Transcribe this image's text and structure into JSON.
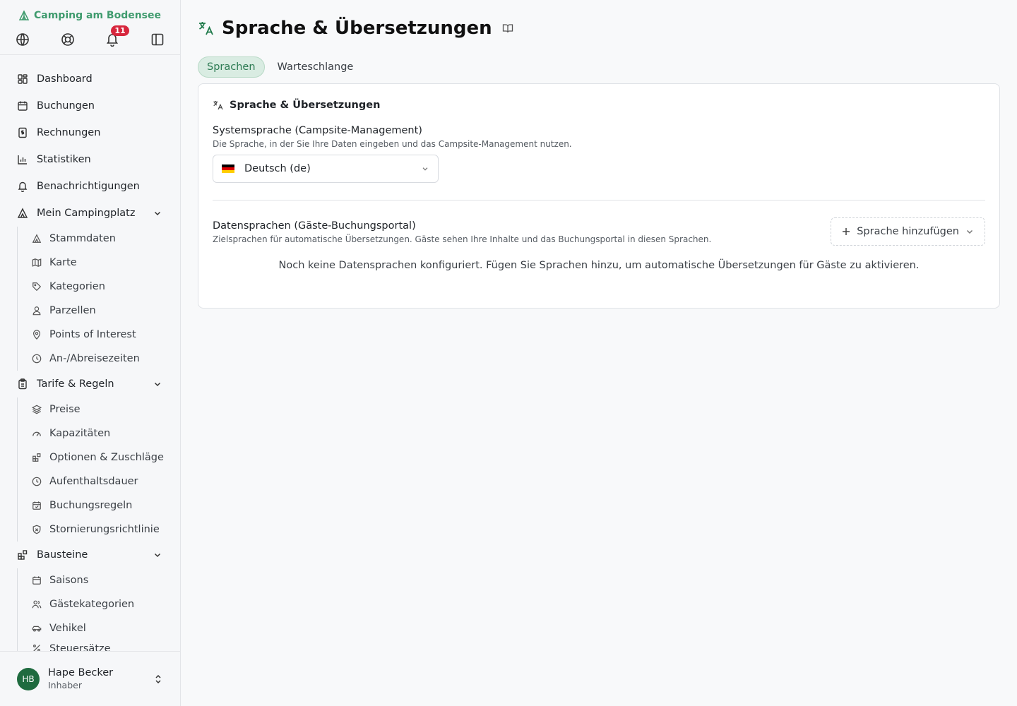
{
  "brand": {
    "name": "Camping am Bodensee"
  },
  "notifications": {
    "count": "11"
  },
  "nav": {
    "dashboard": "Dashboard",
    "buchungen": "Buchungen",
    "rechnungen": "Rechnungen",
    "statistiken": "Statistiken",
    "benachrichtigungen": "Benachrichtigungen",
    "mein_campingplatz": {
      "label": "Mein Campingplatz",
      "items": [
        "Stammdaten",
        "Karte",
        "Kategorien",
        "Parzellen",
        "Points of Interest",
        "An-/Abreisezeiten"
      ]
    },
    "tarife": {
      "label": "Tarife & Regeln",
      "items": [
        "Preise",
        "Kapazitäten",
        "Optionen & Zuschläge",
        "Aufenthaltsdauer",
        "Buchungsregeln",
        "Stornierungsrichtlinie"
      ]
    },
    "bausteine": {
      "label": "Bausteine",
      "items": [
        "Saisons",
        "Gästekategorien",
        "Vehikel",
        "Steuersätze"
      ]
    }
  },
  "user": {
    "initials": "HB",
    "name": "Hape Becker",
    "role": "Inhaber"
  },
  "page": {
    "title": "Sprache & Übersetzungen",
    "tabs": [
      "Sprachen",
      "Warteschlange"
    ],
    "card_title": "Sprache & Übersetzungen",
    "system_lang": {
      "label": "Systemsprache (Campsite-Management)",
      "desc": "Die Sprache, in der Sie Ihre Daten eingeben und das Campsite-Management nutzen.",
      "value": "Deutsch (de)"
    },
    "data_lang": {
      "label": "Datensprachen (Gäste-Buchungsportal)",
      "desc": "Zielsprachen für automatische Übersetzungen. Gäste sehen Ihre Inhalte und das Buchungsportal in diesen Sprachen.",
      "add_label": "Sprache hinzufügen",
      "empty": "Noch keine Datensprachen konfiguriert. Fügen Sie Sprachen hinzu, um automatische Übersetzungen für Gäste zu aktivieren."
    }
  },
  "colors": {
    "accent": "#3f9b6e",
    "badge": "#d7263d",
    "avatar": "#1f6b3f"
  }
}
